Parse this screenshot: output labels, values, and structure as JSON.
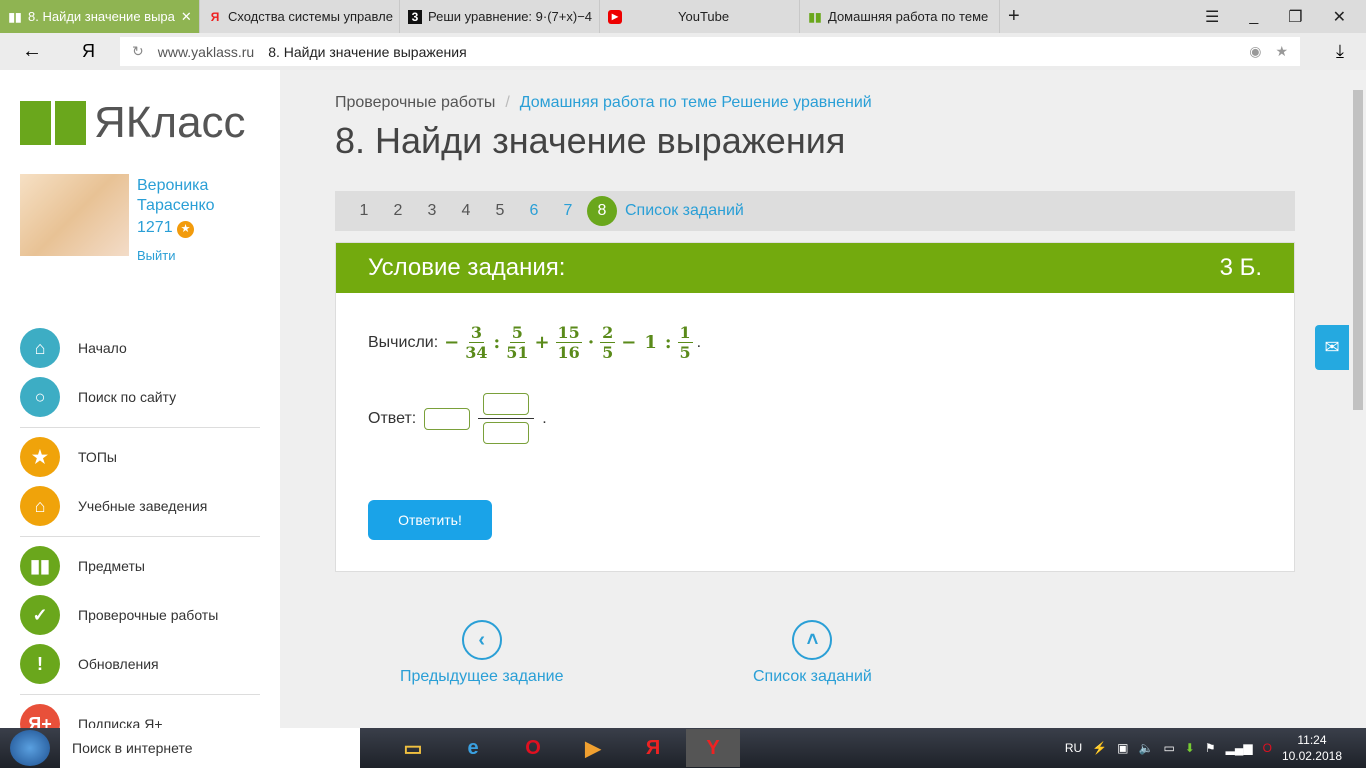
{
  "browser": {
    "tabs": [
      {
        "title": "8. Найди значение выра",
        "icon": "yaklass-icon",
        "active": true
      },
      {
        "title": "Сходства системы управле",
        "icon": "yandex-icon"
      },
      {
        "title": "Реши уравнение: 9·(7+x)−4",
        "icon": "3-icon"
      },
      {
        "title": "YouTube",
        "icon": "youtube-icon"
      },
      {
        "title": "Домашняя работа по теме",
        "icon": "yaklass-icon"
      }
    ],
    "url_domain": "www.yaklass.ru",
    "url_title": "8. Найди значение выражения",
    "yandex": "Я"
  },
  "sidebar": {
    "logo": "ЯКласс",
    "user": {
      "first": "Вероника",
      "last": "Тарасенко",
      "points": "1271",
      "logout": "Выйти"
    },
    "items": [
      {
        "label": "Начало"
      },
      {
        "label": "Поиск по сайту"
      },
      {
        "label": "ТОПы"
      },
      {
        "label": "Учебные заведения"
      },
      {
        "label": "Предметы"
      },
      {
        "label": "Проверочные работы"
      },
      {
        "label": "Обновления"
      },
      {
        "label": "Подписка Я+"
      }
    ]
  },
  "main": {
    "breadcrumb": [
      "Проверочные работы",
      "Домашняя работа по теме Решение уравнений"
    ],
    "title": "8. Найди значение выражения",
    "pager": [
      "1",
      "2",
      "3",
      "4",
      "5",
      "6",
      "7",
      "8"
    ],
    "pager_list": "Список заданий",
    "current": "8",
    "card": {
      "header": "Условие задания:",
      "points": "3 Б.",
      "prompt": "Вычисли:",
      "expr": {
        "minus": "−",
        "f1": [
          "3",
          "34"
        ],
        "op1": ":",
        "f2": [
          "5",
          "51"
        ],
        "op2": "+",
        "f3": [
          "15",
          "16"
        ],
        "op3": "·",
        "f4": [
          "2",
          "5"
        ],
        "op4": "−",
        "n": "1",
        "op5": ":",
        "f5": [
          "1",
          "5"
        ],
        "end": "."
      },
      "answer_label": "Ответ:",
      "answer_end": ".",
      "submit": "Ответить!"
    },
    "prev": "Предыдущее задание",
    "list": "Список заданий"
  },
  "taskbar": {
    "search": "Поиск в интернете",
    "lang": "RU",
    "time": "11:24",
    "date": "10.02.2018"
  },
  "colors": {
    "green": "#73aa0e",
    "blue": "#2a9fd6"
  }
}
